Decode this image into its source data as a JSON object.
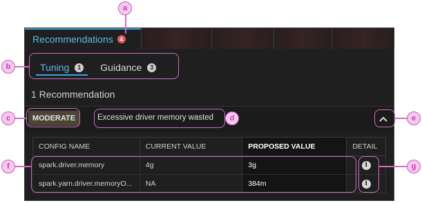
{
  "tabs": {
    "recommendations_label": "Recommendations",
    "recommendations_count": "4"
  },
  "subtabs": [
    {
      "label": "Tuning",
      "count": "1",
      "active": true
    },
    {
      "label": "Guidance",
      "count": "3",
      "active": false
    }
  ],
  "recommendation_count_text": "1 Recommendation",
  "recommendation": {
    "severity": "MODERATE",
    "summary": "Excessive driver memory wasted",
    "expand_icon": "chevron-up-icon"
  },
  "table": {
    "headers": [
      "CONFIG NAME",
      "CURRENT VALUE",
      "PROPOSED VALUE",
      "DETAIL"
    ],
    "rows": [
      {
        "config": "spark.driver.memory",
        "current": "4g",
        "proposed": "3g",
        "detail_icon": "info-icon"
      },
      {
        "config": "spark.yarn.driver.memoryO...",
        "current": "NA",
        "proposed": "384m",
        "detail_icon": "info-icon"
      }
    ]
  },
  "annotations": [
    "a",
    "b",
    "c",
    "d",
    "e",
    "f",
    "g"
  ],
  "colors": {
    "accent": "#3aa3d9",
    "panel_bg": "#1f1f1f",
    "badge_red": "#e05a5a",
    "annotation": "#d06bc3"
  }
}
